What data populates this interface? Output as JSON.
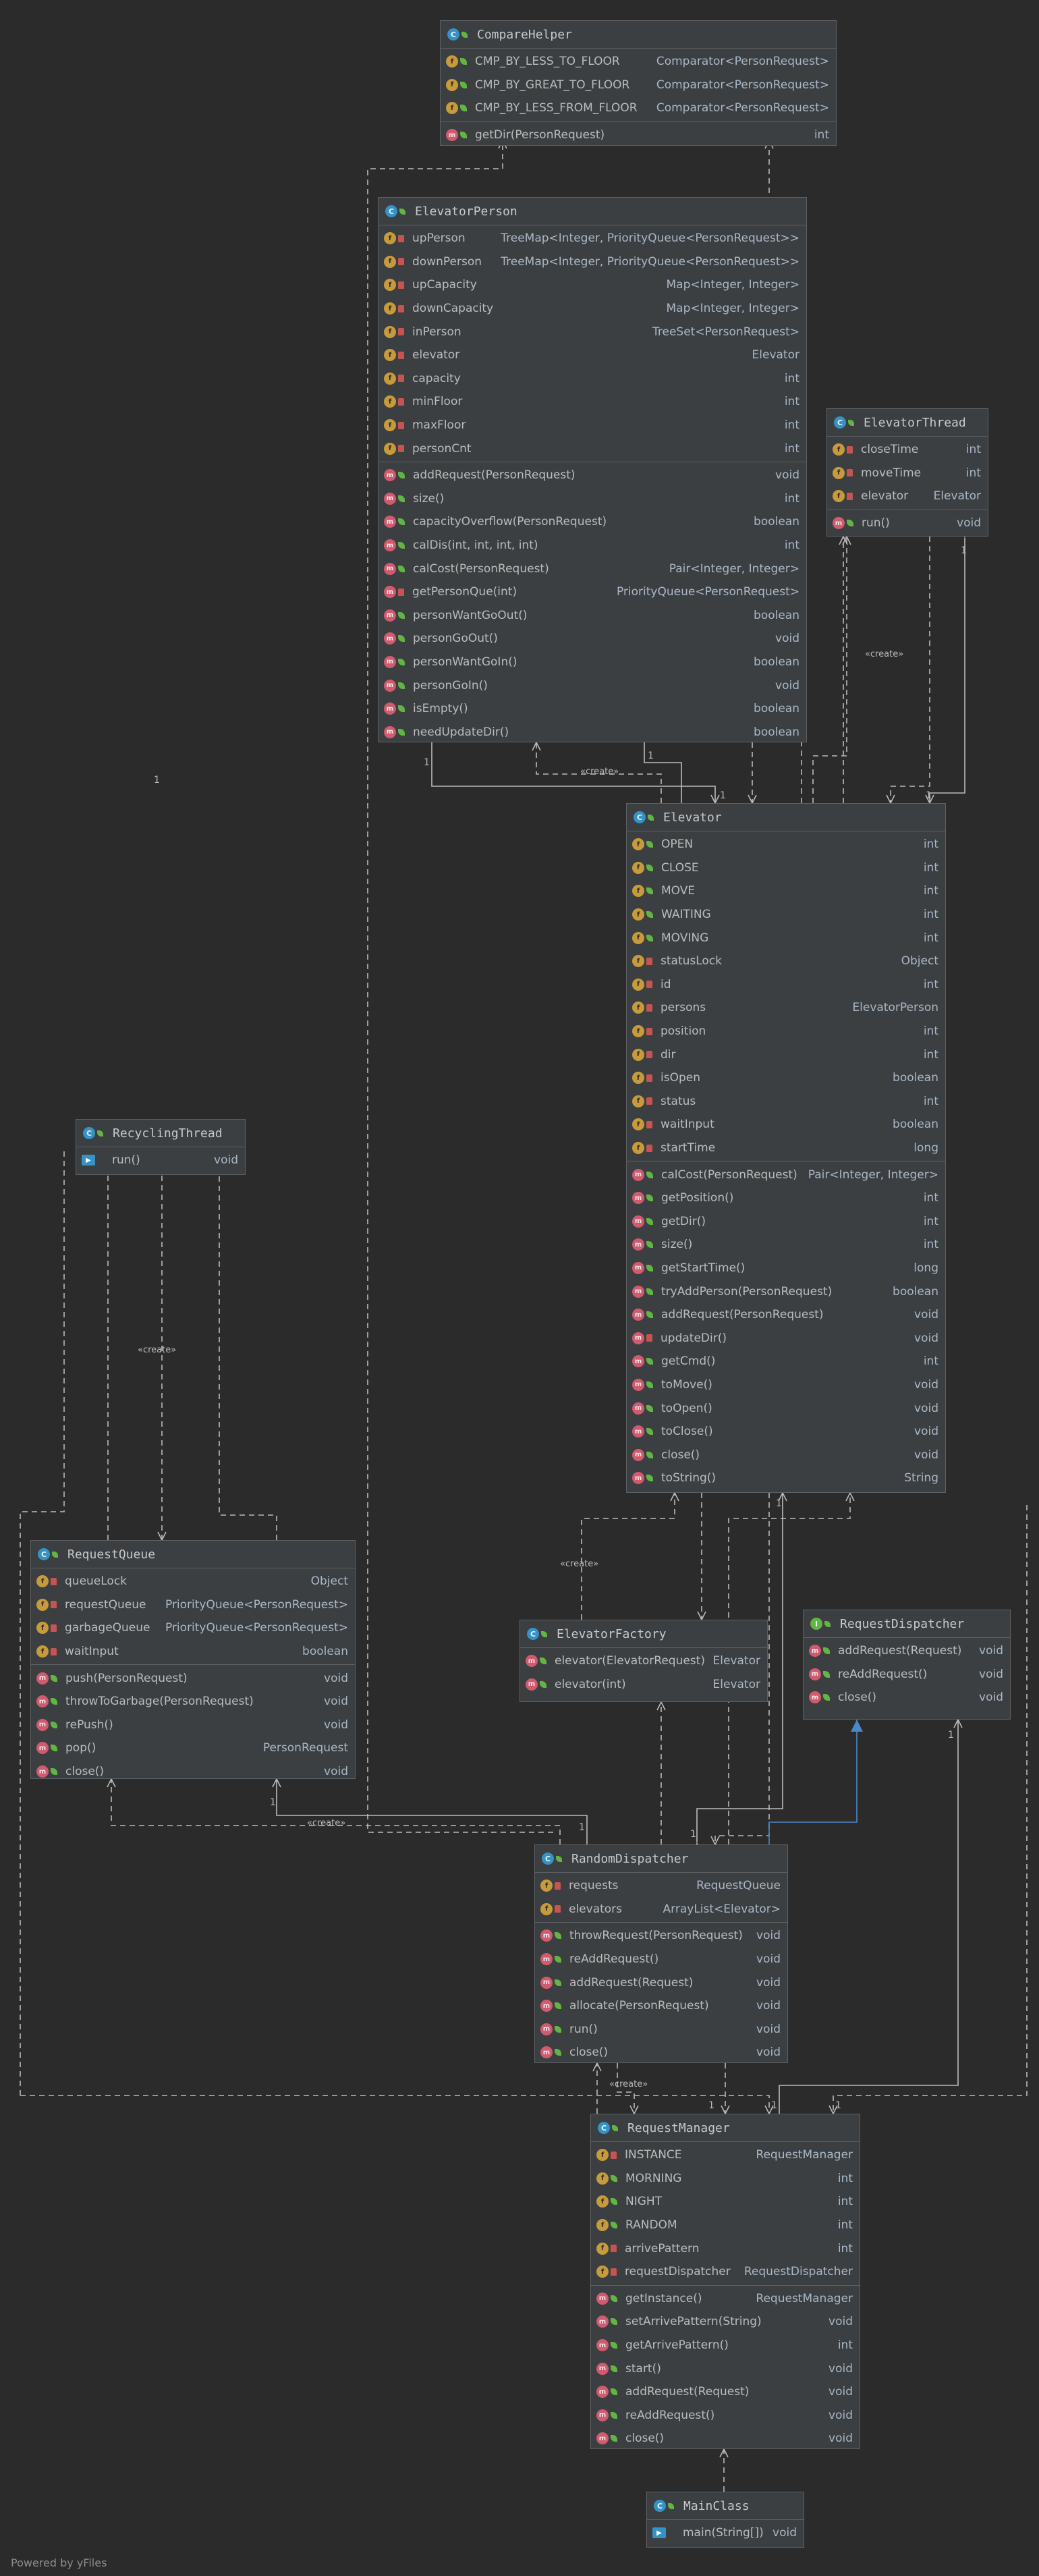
{
  "diagram": {
    "footer": "Powered by yFiles",
    "colors": {
      "background": "#2b2b2b",
      "box": "#3c3f41",
      "border": "#5e6164",
      "edge": "#bbbbbb",
      "realization": "#4a88c7"
    },
    "edge_labels": [
      "«create»",
      "«create»",
      "«create»",
      "«create»",
      "«create»",
      "«create»"
    ],
    "multiplicities": [
      "1",
      "1",
      "1",
      "1",
      "1",
      "1",
      "1",
      "1",
      "1",
      "1",
      "1",
      "1",
      "1",
      "1"
    ],
    "classes": [
      {
        "name": "CompareHelper",
        "fields": [
          {
            "icon": "f",
            "vis": "pub",
            "name": "CMP_BY_LESS_TO_FLOOR",
            "type": "Comparator<PersonRequest>"
          },
          {
            "icon": "f",
            "vis": "pub",
            "name": "CMP_BY_GREAT_TO_FLOOR",
            "type": "Comparator<PersonRequest>"
          },
          {
            "icon": "f",
            "vis": "pub",
            "name": "CMP_BY_LESS_FROM_FLOOR",
            "type": "Comparator<PersonRequest>"
          }
        ],
        "methods": [
          {
            "icon": "m",
            "vis": "pub",
            "name": "getDir(PersonRequest)",
            "type": "int"
          }
        ]
      },
      {
        "name": "ElevatorPerson",
        "fields": [
          {
            "icon": "f",
            "vis": "priv",
            "name": "upPerson",
            "type": "TreeMap<Integer, PriorityQueue<PersonRequest>>"
          },
          {
            "icon": "f",
            "vis": "priv",
            "name": "downPerson",
            "type": "TreeMap<Integer, PriorityQueue<PersonRequest>>"
          },
          {
            "icon": "f",
            "vis": "priv",
            "name": "upCapacity",
            "type": "Map<Integer, Integer>"
          },
          {
            "icon": "f",
            "vis": "priv",
            "name": "downCapacity",
            "type": "Map<Integer, Integer>"
          },
          {
            "icon": "f",
            "vis": "priv",
            "name": "inPerson",
            "type": "TreeSet<PersonRequest>"
          },
          {
            "icon": "f",
            "vis": "priv",
            "name": "elevator",
            "type": "Elevator"
          },
          {
            "icon": "f",
            "vis": "priv",
            "name": "capacity",
            "type": "int"
          },
          {
            "icon": "f",
            "vis": "priv",
            "name": "minFloor",
            "type": "int"
          },
          {
            "icon": "f",
            "vis": "priv",
            "name": "maxFloor",
            "type": "int"
          },
          {
            "icon": "f",
            "vis": "priv",
            "name": "personCnt",
            "type": "int"
          }
        ],
        "methods": [
          {
            "icon": "m",
            "vis": "pub",
            "name": "addRequest(PersonRequest)",
            "type": "void"
          },
          {
            "icon": "m",
            "vis": "pub",
            "name": "size()",
            "type": "int"
          },
          {
            "icon": "m",
            "vis": "pub",
            "name": "capacityOverflow(PersonRequest)",
            "type": "boolean"
          },
          {
            "icon": "m",
            "vis": "pub",
            "name": "calDis(int, int, int, int)",
            "type": "int"
          },
          {
            "icon": "m",
            "vis": "pub",
            "name": "calCost(PersonRequest)",
            "type": "Pair<Integer, Integer>"
          },
          {
            "icon": "m",
            "vis": "priv",
            "name": "getPersonQue(int)",
            "type": "PriorityQueue<PersonRequest>"
          },
          {
            "icon": "m",
            "vis": "pub",
            "name": "personWantGoOut()",
            "type": "boolean"
          },
          {
            "icon": "m",
            "vis": "pub",
            "name": "personGoOut()",
            "type": "void"
          },
          {
            "icon": "m",
            "vis": "pub",
            "name": "personWantGoIn()",
            "type": "boolean"
          },
          {
            "icon": "m",
            "vis": "pub",
            "name": "personGoIn()",
            "type": "void"
          },
          {
            "icon": "m",
            "vis": "pub",
            "name": "isEmpty()",
            "type": "boolean"
          },
          {
            "icon": "m",
            "vis": "pub",
            "name": "needUpdateDir()",
            "type": "boolean"
          }
        ]
      },
      {
        "name": "ElevatorThread",
        "fields": [
          {
            "icon": "f",
            "vis": "priv",
            "name": "closeTime",
            "type": "int"
          },
          {
            "icon": "f",
            "vis": "priv",
            "name": "moveTime",
            "type": "int"
          },
          {
            "icon": "f",
            "vis": "priv",
            "name": "elevator",
            "type": "Elevator"
          }
        ],
        "methods": [
          {
            "icon": "m",
            "vis": "pub",
            "name": "run()",
            "type": "void"
          }
        ]
      },
      {
        "name": "Elevator",
        "fields": [
          {
            "icon": "f",
            "vis": "pub",
            "name": "OPEN",
            "type": "int"
          },
          {
            "icon": "f",
            "vis": "pub",
            "name": "CLOSE",
            "type": "int"
          },
          {
            "icon": "f",
            "vis": "pub",
            "name": "MOVE",
            "type": "int"
          },
          {
            "icon": "f",
            "vis": "pub",
            "name": "WAITING",
            "type": "int"
          },
          {
            "icon": "f",
            "vis": "pub",
            "name": "MOVING",
            "type": "int"
          },
          {
            "icon": "f",
            "vis": "priv",
            "name": "statusLock",
            "type": "Object"
          },
          {
            "icon": "f",
            "vis": "priv",
            "name": "id",
            "type": "int"
          },
          {
            "icon": "f",
            "vis": "priv",
            "name": "persons",
            "type": "ElevatorPerson"
          },
          {
            "icon": "f",
            "vis": "priv",
            "name": "position",
            "type": "int"
          },
          {
            "icon": "f",
            "vis": "priv",
            "name": "dir",
            "type": "int"
          },
          {
            "icon": "f",
            "vis": "priv",
            "name": "isOpen",
            "type": "boolean"
          },
          {
            "icon": "f",
            "vis": "priv",
            "name": "status",
            "type": "int"
          },
          {
            "icon": "f",
            "vis": "priv",
            "name": "waitInput",
            "type": "boolean"
          },
          {
            "icon": "f",
            "vis": "priv",
            "name": "startTime",
            "type": "long"
          }
        ],
        "methods": [
          {
            "icon": "m",
            "vis": "pub",
            "name": "calCost(PersonRequest)",
            "type": "Pair<Integer, Integer>"
          },
          {
            "icon": "m",
            "vis": "pub",
            "name": "getPosition()",
            "type": "int"
          },
          {
            "icon": "m",
            "vis": "pub",
            "name": "getDir()",
            "type": "int"
          },
          {
            "icon": "m",
            "vis": "pub",
            "name": "size()",
            "type": "int"
          },
          {
            "icon": "m",
            "vis": "pub",
            "name": "getStartTime()",
            "type": "long"
          },
          {
            "icon": "m",
            "vis": "pub",
            "name": "tryAddPerson(PersonRequest)",
            "type": "boolean"
          },
          {
            "icon": "m",
            "vis": "pub",
            "name": "addRequest(PersonRequest)",
            "type": "void"
          },
          {
            "icon": "m",
            "vis": "priv",
            "name": "updateDir()",
            "type": "void"
          },
          {
            "icon": "m",
            "vis": "pub",
            "name": "getCmd()",
            "type": "int"
          },
          {
            "icon": "m",
            "vis": "pub",
            "name": "toMove()",
            "type": "void"
          },
          {
            "icon": "m",
            "vis": "pub",
            "name": "toOpen()",
            "type": "void"
          },
          {
            "icon": "m",
            "vis": "pub",
            "name": "toClose()",
            "type": "void"
          },
          {
            "icon": "m",
            "vis": "pub",
            "name": "close()",
            "type": "void"
          },
          {
            "icon": "m",
            "vis": "pub",
            "name": "toString()",
            "type": "String"
          }
        ]
      },
      {
        "name": "RecyclingThread",
        "fields": [],
        "methods": [
          {
            "icon": "mainic",
            "vis": "none",
            "name": "run()",
            "type": "void"
          }
        ]
      },
      {
        "name": "RequestQueue",
        "fields": [
          {
            "icon": "f",
            "vis": "priv",
            "name": "queueLock",
            "type": "Object"
          },
          {
            "icon": "f",
            "vis": "priv",
            "name": "requestQueue",
            "type": "PriorityQueue<PersonRequest>"
          },
          {
            "icon": "f",
            "vis": "priv",
            "name": "garbageQueue",
            "type": "PriorityQueue<PersonRequest>"
          },
          {
            "icon": "f",
            "vis": "priv",
            "name": "waitInput",
            "type": "boolean"
          }
        ],
        "methods": [
          {
            "icon": "m",
            "vis": "pub",
            "name": "push(PersonRequest)",
            "type": "void"
          },
          {
            "icon": "m",
            "vis": "pub",
            "name": "throwToGarbage(PersonRequest)",
            "type": "void"
          },
          {
            "icon": "m",
            "vis": "pub",
            "name": "rePush()",
            "type": "void"
          },
          {
            "icon": "m",
            "vis": "pub",
            "name": "pop()",
            "type": "PersonRequest"
          },
          {
            "icon": "m",
            "vis": "pub",
            "name": "close()",
            "type": "void"
          }
        ]
      },
      {
        "name": "ElevatorFactory",
        "fields": [],
        "methods": [
          {
            "icon": "m",
            "vis": "pub",
            "name": "elevator(ElevatorRequest)",
            "type": "Elevator"
          },
          {
            "icon": "m",
            "vis": "pub",
            "name": "elevator(int)",
            "type": "Elevator"
          }
        ]
      },
      {
        "name": "RequestDispatcher",
        "fields": [],
        "methods": [
          {
            "icon": "m",
            "vis": "pub",
            "name": "addRequest(Request)",
            "type": "void"
          },
          {
            "icon": "m",
            "vis": "pub",
            "name": "reAddRequest()",
            "type": "void"
          },
          {
            "icon": "m",
            "vis": "pub",
            "name": "close()",
            "type": "void"
          }
        ]
      },
      {
        "name": "RandomDispatcher",
        "fields": [
          {
            "icon": "f",
            "vis": "priv",
            "name": "requests",
            "type": "RequestQueue"
          },
          {
            "icon": "f",
            "vis": "priv",
            "name": "elevators",
            "type": "ArrayList<Elevator>"
          }
        ],
        "methods": [
          {
            "icon": "m",
            "vis": "pub",
            "name": "throwRequest(PersonRequest)",
            "type": "void"
          },
          {
            "icon": "m",
            "vis": "pub",
            "name": "reAddRequest()",
            "type": "void"
          },
          {
            "icon": "m",
            "vis": "pub",
            "name": "addRequest(Request)",
            "type": "void"
          },
          {
            "icon": "m",
            "vis": "pub",
            "name": "allocate(PersonRequest)",
            "type": "void"
          },
          {
            "icon": "m",
            "vis": "pub",
            "name": "run()",
            "type": "void"
          },
          {
            "icon": "m",
            "vis": "pub",
            "name": "close()",
            "type": "void"
          }
        ]
      },
      {
        "name": "RequestManager",
        "fields": [
          {
            "icon": "f",
            "vis": "priv",
            "name": "INSTANCE",
            "type": "RequestManager"
          },
          {
            "icon": "f",
            "vis": "pub",
            "name": "MORNING",
            "type": "int"
          },
          {
            "icon": "f",
            "vis": "pub",
            "name": "NIGHT",
            "type": "int"
          },
          {
            "icon": "f",
            "vis": "pub",
            "name": "RANDOM",
            "type": "int"
          },
          {
            "icon": "f",
            "vis": "priv",
            "name": "arrivePattern",
            "type": "int"
          },
          {
            "icon": "f",
            "vis": "priv",
            "name": "requestDispatcher",
            "type": "RequestDispatcher"
          }
        ],
        "methods": [
          {
            "icon": "m",
            "vis": "pub",
            "name": "getInstance()",
            "type": "RequestManager"
          },
          {
            "icon": "m",
            "vis": "pub",
            "name": "setArrivePattern(String)",
            "type": "void"
          },
          {
            "icon": "m",
            "vis": "pub",
            "name": "getArrivePattern()",
            "type": "int"
          },
          {
            "icon": "m",
            "vis": "pub",
            "name": "start()",
            "type": "void"
          },
          {
            "icon": "m",
            "vis": "pub",
            "name": "addRequest(Request)",
            "type": "void"
          },
          {
            "icon": "m",
            "vis": "pub",
            "name": "reAddRequest()",
            "type": "void"
          },
          {
            "icon": "m",
            "vis": "pub",
            "name": "close()",
            "type": "void"
          }
        ]
      },
      {
        "name": "MainClass",
        "fields": [],
        "methods": [
          {
            "icon": "mainic",
            "vis": "none",
            "name": "main(String[])",
            "type": "void"
          }
        ]
      }
    ]
  }
}
